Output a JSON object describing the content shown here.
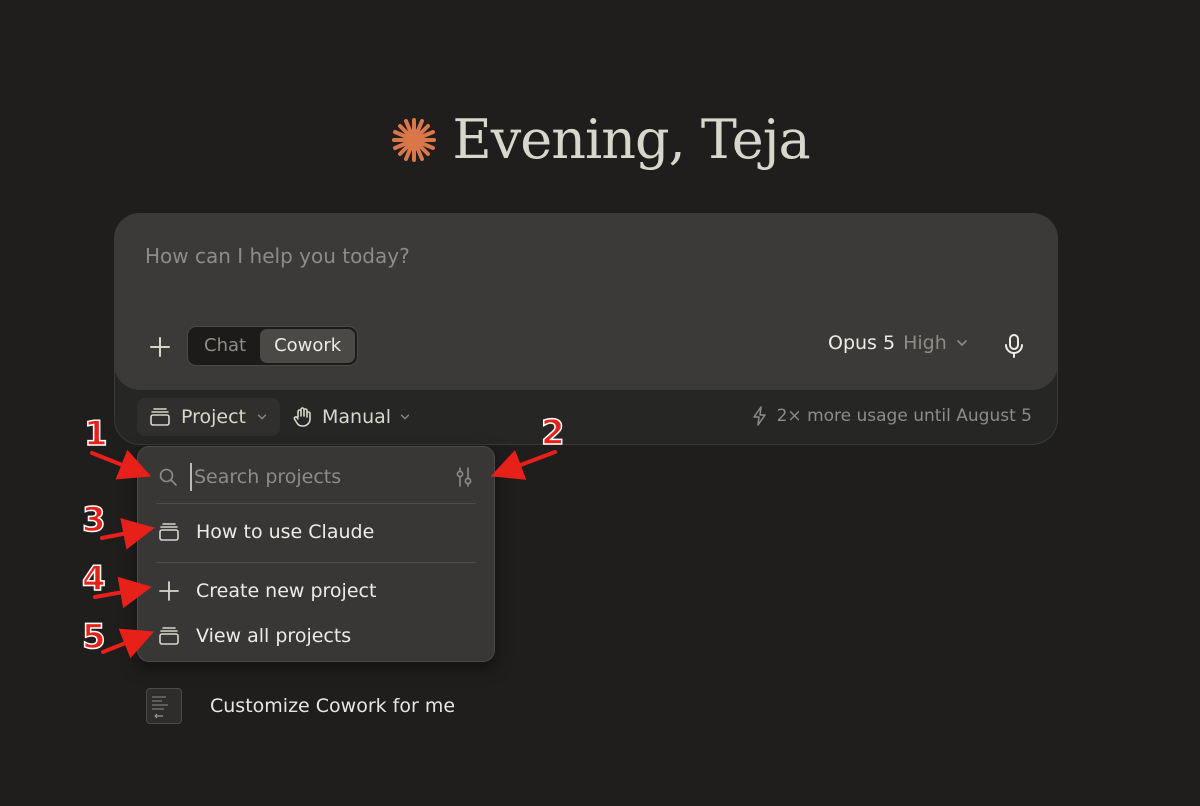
{
  "greeting": {
    "text": "Evening, Teja",
    "accent_color": "#d9774b"
  },
  "composer": {
    "placeholder": "How can I help you today?",
    "modes": [
      "Chat",
      "Cowork"
    ],
    "active_mode": "Cowork",
    "model": {
      "name": "Opus 5",
      "effort": "High"
    }
  },
  "toolbar": {
    "project_label": "Project",
    "manual_label": "Manual",
    "usage_note": "2× more usage until August 5"
  },
  "project_dropdown": {
    "search_placeholder": "Search projects",
    "projects": [
      "How to use Claude"
    ],
    "actions": {
      "create": "Create new project",
      "view_all": "View all projects"
    }
  },
  "annotations": [
    "1",
    "2",
    "3",
    "4",
    "5"
  ],
  "annotation_color": "#e8201a",
  "suggestion": {
    "label": "Customize Cowork for me"
  }
}
